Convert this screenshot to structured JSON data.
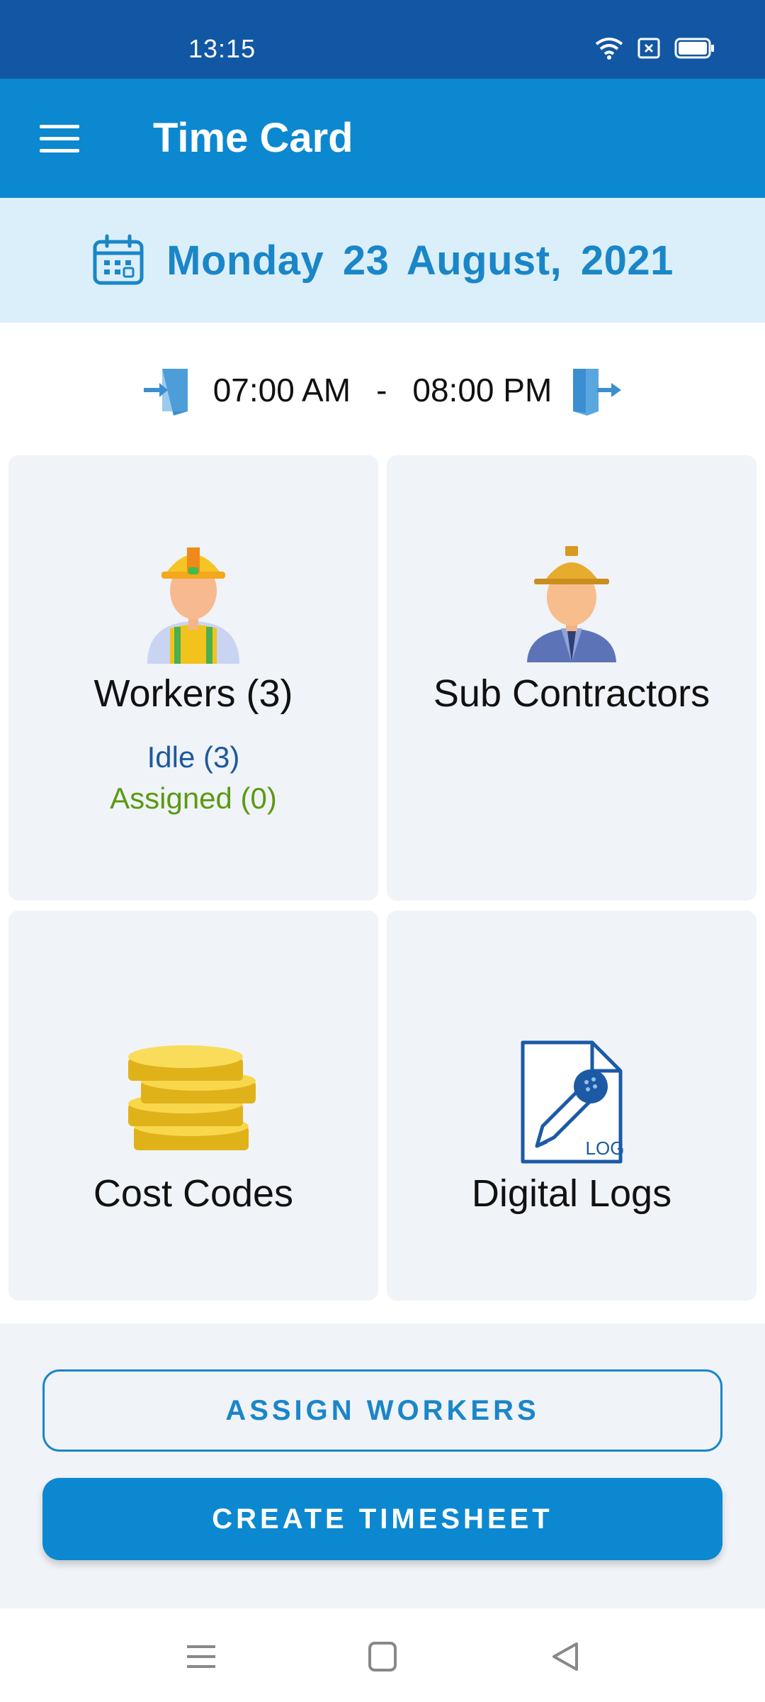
{
  "status_bar": {
    "time": "13:15"
  },
  "app_bar": {
    "title": "Time Card"
  },
  "date_bar": {
    "date": "Monday  23  August, 2021"
  },
  "shift": {
    "start": "07:00 AM",
    "separator": "-",
    "end": "08:00 PM"
  },
  "tiles": {
    "workers": {
      "label": "Workers (3)",
      "idle": "Idle (3)",
      "assigned": "Assigned (0)"
    },
    "sub_contractors": {
      "label": "Sub Contractors"
    },
    "cost_codes": {
      "label": "Cost Codes"
    },
    "digital_logs": {
      "label": "Digital Logs",
      "icon_text": "LOG"
    }
  },
  "actions": {
    "assign_label": "ASSIGN WORKERS",
    "create_label": "CREATE TIMESHEET"
  },
  "colors": {
    "primary": "#0c88d0",
    "status_bar": "#1257a3",
    "date_bg": "#dbeffa",
    "idle": "#1c5a9c",
    "assigned": "#5b9a12"
  }
}
